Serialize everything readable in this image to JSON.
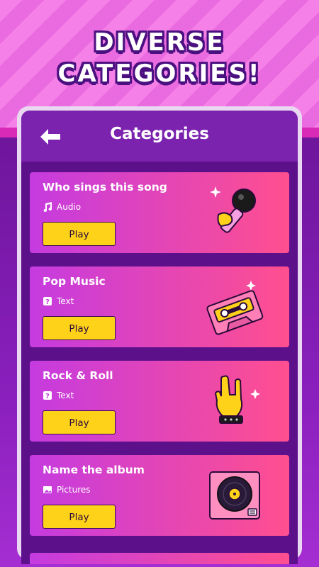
{
  "headline": {
    "line1": "DIVERSE",
    "line2": "CATEGORIES!"
  },
  "appbar": {
    "title": "Categories",
    "back_icon": "back-arrow-icon"
  },
  "colors": {
    "accent": "#ffd21a",
    "card_start": "#c53be0",
    "card_end": "#ff4f8f",
    "background": "#5c118a"
  },
  "categories": [
    {
      "title": "Who sings this song",
      "type": "Audio",
      "type_icon": "music-note-icon",
      "play_label": "Play",
      "art": "microphone-icon"
    },
    {
      "title": "Pop Music",
      "type": "Text",
      "type_icon": "question-mark-icon",
      "play_label": "Play",
      "art": "cassette-tape-icon"
    },
    {
      "title": "Rock & Roll",
      "type": "Text",
      "type_icon": "question-mark-icon",
      "play_label": "Play",
      "art": "rock-hand-icon"
    },
    {
      "title": "Name the album",
      "type": "Pictures",
      "type_icon": "picture-icon",
      "play_label": "Play",
      "art": "vinyl-record-icon"
    }
  ]
}
